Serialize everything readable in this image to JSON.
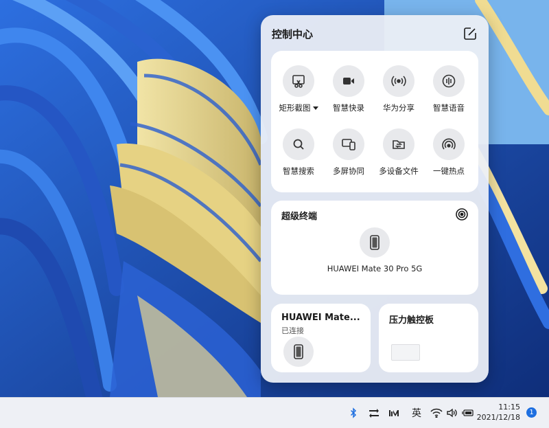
{
  "control_center": {
    "title": "控制中心",
    "quick_actions": [
      {
        "label": "矩形截图",
        "icon": "screenshot-icon",
        "has_dropdown": true
      },
      {
        "label": "智慧快录",
        "icon": "video-record-icon"
      },
      {
        "label": "华为分享",
        "icon": "huawei-share-icon"
      },
      {
        "label": "智慧语音",
        "icon": "voice-assistant-icon"
      },
      {
        "label": "智慧搜索",
        "icon": "search-icon"
      },
      {
        "label": "多屏协同",
        "icon": "multi-screen-icon"
      },
      {
        "label": "多设备文件",
        "icon": "multi-device-files-icon"
      },
      {
        "label": "一键热点",
        "icon": "hotspot-icon"
      }
    ],
    "super_device": {
      "title": "超级终端",
      "device_name": "HUAWEI Mate 30 Pro 5G"
    },
    "phone_card": {
      "name": "HUAWEI Mate...",
      "status": "已连接"
    },
    "touchpad_card": {
      "title": "压力触控板"
    }
  },
  "taskbar": {
    "ime_label": "英",
    "time": "11:15",
    "date": "2021/12/18",
    "notification_count": "1",
    "icons": [
      "bluetooth-icon",
      "transfer-icon",
      "huawei-pc-manager-icon",
      "wifi-icon",
      "volume-icon",
      "battery-icon"
    ]
  },
  "colors": {
    "panel_bg": "#eceff5",
    "accent_blue": "#1e6fe0",
    "wallpaper_blue": "#1d4fb0",
    "wallpaper_yellow": "#e8d48a"
  }
}
